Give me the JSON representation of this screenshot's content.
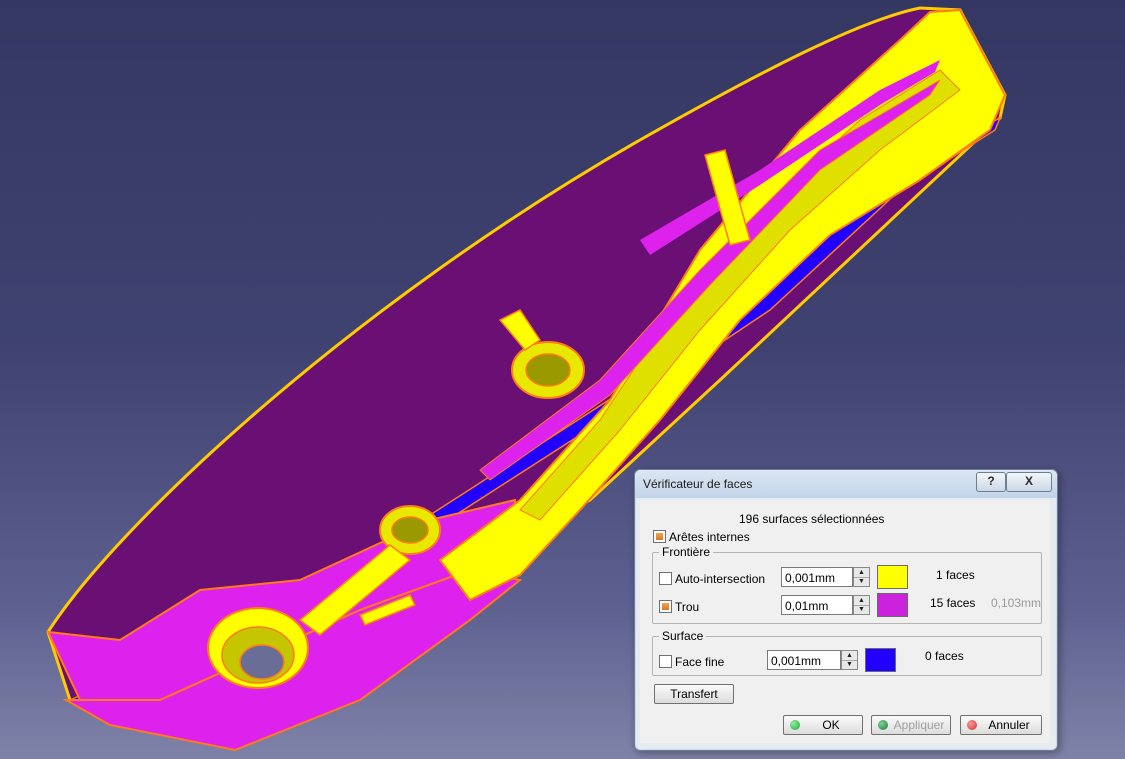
{
  "dialog": {
    "title": "Vérificateur de faces",
    "help_label": "?",
    "close_label": "X",
    "selection_summary": "196 surfaces sélectionnées",
    "internal_edges": {
      "label": "Arêtes internes",
      "checked": true
    },
    "frontier": {
      "legend": "Frontière",
      "rows": [
        {
          "label": "Auto-intersection",
          "checked": false,
          "value": "0,001mm",
          "color": "#ffff00",
          "count": "1 faces",
          "extra": ""
        },
        {
          "label": "Trou",
          "checked": true,
          "value": "0,01mm",
          "color": "#cc22dd",
          "count": "15 faces",
          "extra": "0,103mm"
        }
      ]
    },
    "surface": {
      "legend": "Surface",
      "rows": [
        {
          "label": "Face fine",
          "checked": false,
          "value": "0,001mm",
          "color": "#2200ff",
          "count": "0 faces"
        }
      ]
    },
    "transfer_label": "Transfert",
    "buttons": {
      "ok": {
        "label": "OK",
        "color": "#1fa83a"
      },
      "apply": {
        "label": "Appliquer",
        "color": "#1e7a3a",
        "enabled": false
      },
      "cancel": {
        "label": "Annuler",
        "color": "#d0312d"
      }
    }
  },
  "colors": {
    "background_top": "#353763",
    "background_bottom": "#7f82a8",
    "part_yellow": "#ffff00",
    "part_magenta": "#cc22dd",
    "part_purple": "#6a0f73",
    "part_blue": "#2200ff",
    "edge_orange": "#ff7a1a"
  }
}
